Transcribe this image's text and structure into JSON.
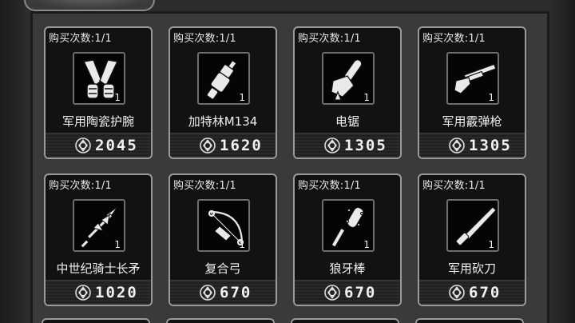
{
  "shop": {
    "items": [
      {
        "count": "购买次数:1/1",
        "name": "军用陶瓷护腕",
        "qty": "1",
        "price": "2045",
        "icon": "ceramic-bracers-icon"
      },
      {
        "count": "购买次数:1/1",
        "name": "加特林M134",
        "qty": "1",
        "price": "1620",
        "icon": "gatling-gun-icon"
      },
      {
        "count": "购买次数:1/1",
        "name": "电锯",
        "qty": "1",
        "price": "1305",
        "icon": "chainsaw-icon"
      },
      {
        "count": "购买次数:1/1",
        "name": "军用霰弹枪",
        "qty": "1",
        "price": "1305",
        "icon": "shotgun-icon"
      },
      {
        "count": "购买次数:1/1",
        "name": "中世纪骑士长矛",
        "qty": "1",
        "price": "1020",
        "icon": "knight-lance-icon"
      },
      {
        "count": "购买次数:1/1",
        "name": "复合弓",
        "qty": "1",
        "price": "670",
        "icon": "compound-bow-icon"
      },
      {
        "count": "购买次数:1/1",
        "name": "狼牙棒",
        "qty": "1",
        "price": "670",
        "icon": "spiked-club-icon"
      },
      {
        "count": "购买次数:1/1",
        "name": "军用砍刀",
        "qty": "1",
        "price": "670",
        "icon": "machete-icon"
      }
    ]
  },
  "colors": {
    "card_bg": "#121212",
    "card_border": "#9a9a9a",
    "panel_bg": "#3a3a3a",
    "text": "#f0f0f0"
  }
}
